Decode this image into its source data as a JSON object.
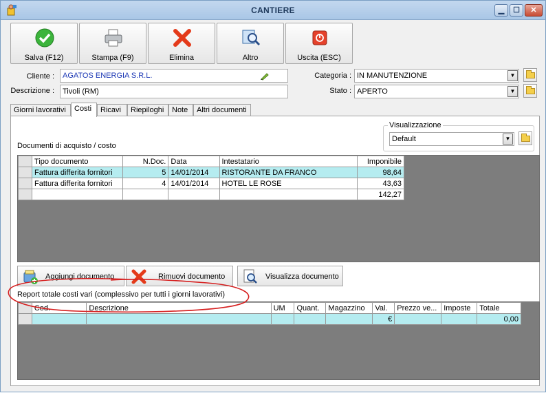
{
  "window": {
    "title": "CANTIERE",
    "minimize": "▁",
    "maximize": "☐",
    "close": "✕"
  },
  "toolbar": {
    "save": "Salva (F12)",
    "print": "Stampa (F9)",
    "delete": "Elimina",
    "other": "Altro",
    "exit": "Uscita (ESC)"
  },
  "form": {
    "cliente_label": "Cliente :",
    "cliente_value": "AGATOS ENERGIA S.R.L.",
    "descrizione_label": "Descrizione :",
    "descrizione_value": "Tivoli (RM)",
    "categoria_label": "Categoria :",
    "categoria_value": "IN MANUTENZIONE",
    "stato_label": "Stato :",
    "stato_value": "APERTO"
  },
  "tabs": [
    "Giorni lavorativi",
    "Costi",
    "Ricavi",
    "Riepiloghi",
    "Note",
    "Altri documenti"
  ],
  "active_tab": "Costi",
  "visualizzazione": {
    "label": "Visualizzazione",
    "value": "Default"
  },
  "documents": {
    "title": "Documenti di acquisto / costo",
    "columns": [
      "Tipo documento",
      "N.Doc.",
      "Data",
      "Intestatario",
      "Imponibile"
    ],
    "rows": [
      [
        "Fattura differita fornitori",
        "5",
        "14/01/2014",
        "RISTORANTE DA FRANCO",
        "98,64"
      ],
      [
        "Fattura differita fornitori",
        "4",
        "14/01/2014",
        "HOTEL LE ROSE",
        "43,63"
      ]
    ],
    "total": "142,27"
  },
  "actions": {
    "add": "Aggiungi documento",
    "remove": "Rimuovi documento",
    "view": "Visualizza documento"
  },
  "report": {
    "title": "Report totale costi vari (complessivo per tutti i giorni lavorativi)",
    "columns": [
      "Cod.",
      "Descrizione",
      "UM",
      "Quant.",
      "Magazzino",
      "Val.",
      "Prezzo ve...",
      "Imposte",
      "Totale"
    ],
    "row": {
      "valuta": "€",
      "totale": "0,00"
    }
  },
  "colors": {
    "selected_row": "#b5ecf0",
    "grid_bg": "#7d7d7d",
    "annotation": "#d62020"
  }
}
